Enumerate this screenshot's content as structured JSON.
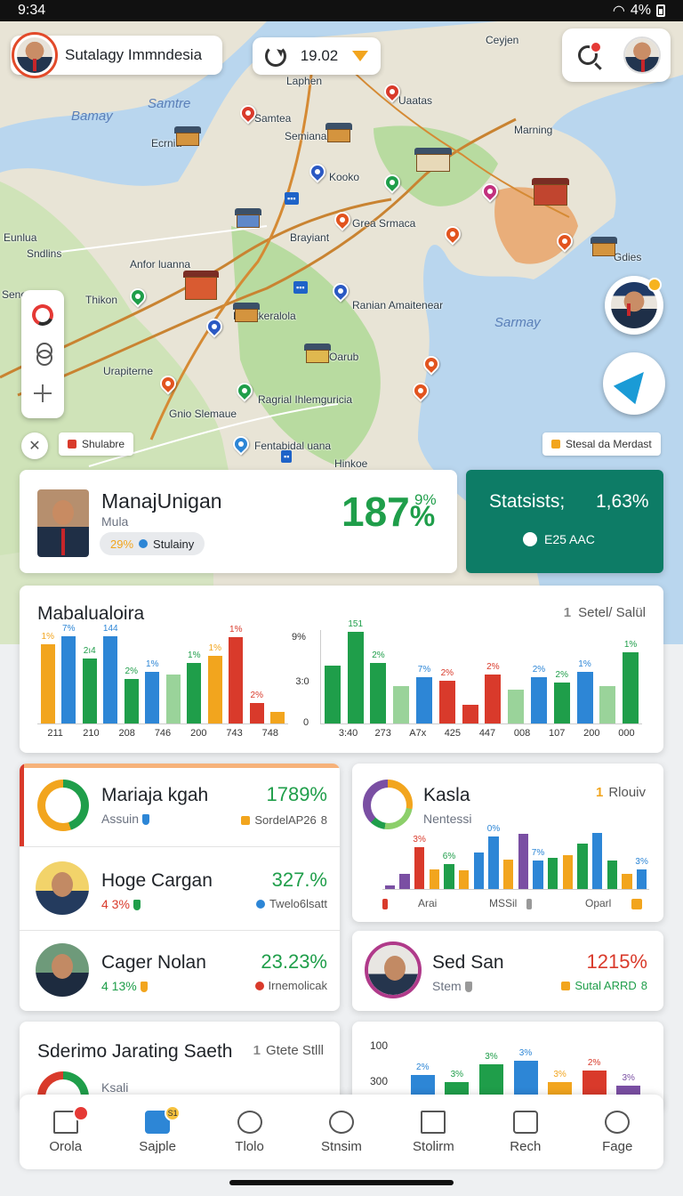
{
  "status_bar": {
    "time": "9:34",
    "battery": "4%"
  },
  "colors": {
    "green": "#1f9e4a",
    "red": "#d93a2b",
    "orange": "#f2a51e",
    "blue": "#2d86d6",
    "teal": "#0d7c66"
  },
  "search": {
    "title": "Sutalagy Immndesia"
  },
  "time_chip": {
    "value": "19.02"
  },
  "map": {
    "labels": [
      "Ceyjen",
      "Laphen",
      "Bamay",
      "Samtre",
      "Ecrnia",
      "Semiana",
      "Samtea",
      "Kooko",
      "Uaatas",
      "Marning",
      "Grea Srmaca",
      "Brayiant",
      "Anfor luanna",
      "Thikon",
      "Filcatkeralola",
      "Ranian Amaitenear",
      "Sarmay",
      "Oarub",
      "Urapiterne",
      "Ragrial Ihlemguricia",
      "Gnio Slemaue",
      "Fentabidal uana",
      "Hinkoe",
      "Sndlins",
      "Eunlua",
      "Gdies",
      "Seneo"
    ],
    "chip_left": "Shulabre",
    "chip_right": "Stesal da Merdast"
  },
  "summary": {
    "name": "ManajUnigan",
    "sub": "Mula",
    "pill_value": "29%",
    "pill_label": "Stulainy",
    "big_value": "187",
    "big_suffix": "%",
    "small_value": "9%"
  },
  "stats": {
    "title": "Statsists;",
    "value": "1,63%",
    "sub": "E25 AAC"
  },
  "chart1": {
    "title": "Mabalualoira",
    "right_label": "Setel/ Salül",
    "right_index": "1",
    "y_labels": [
      "9%",
      "3:0",
      "0"
    ],
    "left_ticks": [
      "211",
      "210",
      "208",
      "746",
      "200",
      "743",
      "748"
    ],
    "right_ticks": [
      "3:40",
      "273",
      "A7x",
      "425",
      "447",
      "008",
      "107",
      "200",
      "000"
    ]
  },
  "chart_data": [
    {
      "type": "bar",
      "title": "Mabalualoira",
      "bars": [
        {
          "label": "1%",
          "value": 85,
          "color": "#f2a51e"
        },
        {
          "label": "7%",
          "value": 93,
          "color": "#2d86d6"
        },
        {
          "label": "2ı4",
          "value": 70,
          "color": "#1f9e4a"
        },
        {
          "label": "144",
          "value": 93,
          "color": "#2d86d6"
        },
        {
          "label": "2%",
          "value": 48,
          "color": "#1f9e4a"
        },
        {
          "label": "1%",
          "value": 55,
          "color": "#2d86d6"
        },
        {
          "label": "",
          "value": 52,
          "color": "#9ad39a"
        },
        {
          "label": "1%",
          "value": 65,
          "color": "#1f9e4a"
        },
        {
          "label": "1%",
          "value": 72,
          "color": "#f2a51e"
        },
        {
          "label": "1%",
          "value": 92,
          "color": "#d93a2b"
        },
        {
          "label": "2%",
          "value": 22,
          "color": "#d93a2b"
        },
        {
          "label": "",
          "value": 12,
          "color": "#f2a51e"
        }
      ]
    },
    {
      "type": "bar",
      "bars": [
        {
          "label": "",
          "value": 62,
          "color": "#1f9e4a"
        },
        {
          "label": "151",
          "value": 98,
          "color": "#1f9e4a"
        },
        {
          "label": "2%",
          "value": 65,
          "color": "#1f9e4a"
        },
        {
          "label": "",
          "value": 40,
          "color": "#9ad39a"
        },
        {
          "label": "7%",
          "value": 50,
          "color": "#2d86d6"
        },
        {
          "label": "2%",
          "value": 46,
          "color": "#d93a2b"
        },
        {
          "label": "",
          "value": 20,
          "color": "#d93a2b"
        },
        {
          "label": "2%",
          "value": 52,
          "color": "#d93a2b"
        },
        {
          "label": "",
          "value": 36,
          "color": "#9ad39a"
        },
        {
          "label": "2%",
          "value": 50,
          "color": "#2d86d6"
        },
        {
          "label": "2%",
          "value": 44,
          "color": "#1f9e4a"
        },
        {
          "label": "1%",
          "value": 55,
          "color": "#2d86d6"
        },
        {
          "label": "",
          "value": 40,
          "color": "#9ad39a"
        },
        {
          "label": "1%",
          "value": 76,
          "color": "#1f9e4a"
        }
      ]
    },
    {
      "type": "bar",
      "title": "Kasla",
      "bars": [
        {
          "label": "",
          "value": 5,
          "color": "#7a4fa3"
        },
        {
          "label": "",
          "value": 22,
          "color": "#7a4fa3"
        },
        {
          "label": "3%",
          "value": 60,
          "color": "#d93a2b"
        },
        {
          "label": "",
          "value": 28,
          "color": "#f2a51e"
        },
        {
          "label": "6%",
          "value": 35,
          "color": "#1f9e4a"
        },
        {
          "label": "",
          "value": 26,
          "color": "#f2a51e"
        },
        {
          "label": "",
          "value": 52,
          "color": "#2d86d6"
        },
        {
          "label": "0%",
          "value": 75,
          "color": "#2d86d6"
        },
        {
          "label": "",
          "value": 42,
          "color": "#f2a51e"
        },
        {
          "label": "",
          "value": 78,
          "color": "#7a4fa3"
        },
        {
          "label": "7%",
          "value": 40,
          "color": "#2d86d6"
        },
        {
          "label": "",
          "value": 44,
          "color": "#1f9e4a"
        },
        {
          "label": "",
          "value": 48,
          "color": "#f2a51e"
        },
        {
          "label": "",
          "value": 65,
          "color": "#1f9e4a"
        },
        {
          "label": "",
          "value": 80,
          "color": "#2d86d6"
        },
        {
          "label": "",
          "value": 40,
          "color": "#1f9e4a"
        },
        {
          "label": "",
          "value": 22,
          "color": "#f2a51e"
        },
        {
          "label": "3%",
          "value": 28,
          "color": "#2d86d6"
        }
      ]
    },
    {
      "type": "bar",
      "bars": [
        {
          "label": "2%",
          "value": 45,
          "color": "#2d86d6"
        },
        {
          "label": "3%",
          "value": 30,
          "color": "#1f9e4a"
        },
        {
          "label": "3%",
          "value": 70,
          "color": "#1f9e4a"
        },
        {
          "label": "3%",
          "value": 80,
          "color": "#2d86d6"
        },
        {
          "label": "3%",
          "value": 30,
          "color": "#f2a51e"
        },
        {
          "label": "2%",
          "value": 56,
          "color": "#d93a2b"
        },
        {
          "label": "3%",
          "value": 20,
          "color": "#7a4fa3"
        }
      ]
    }
  ],
  "list": [
    {
      "name": "Mariaja kgah",
      "sub": "Assuin",
      "value": "1789%",
      "tag": "SordelAP26",
      "tag_suffix": "8"
    },
    {
      "name": "Hoge Cargan",
      "sub": "4 3%",
      "value": "327.%",
      "tag": "Twelo6lsatt"
    },
    {
      "name": "Cager Nolan",
      "sub": "4 13%",
      "value": "23.23%",
      "tag": "Irnemolicak"
    }
  ],
  "kasla": {
    "title": "Kasla",
    "index": "1",
    "label": "Rlouiv",
    "sub": "Nentessi",
    "ticks": [
      "Arai",
      "MSSil",
      "Oparl"
    ]
  },
  "sed": {
    "name": "Sed San",
    "sub": "Stem",
    "value": "1215%",
    "tag": "Sutal ARRD",
    "tag_suffix": "8"
  },
  "bottom_left": {
    "title": "Sderimo Jarating Saeth",
    "index": "1",
    "label": "Gtete Stlll",
    "sub": "Ksali"
  },
  "bottom_right": {
    "y_labels": [
      "100",
      "300"
    ]
  },
  "nav": [
    {
      "label": "Orola",
      "badge": ""
    },
    {
      "label": "Sajple",
      "badge": "S1"
    },
    {
      "label": "Tlolo",
      "badge": ""
    },
    {
      "label": "Stnsim",
      "badge": ""
    },
    {
      "label": "Stolirm",
      "badge": ""
    },
    {
      "label": "Rech",
      "badge": ""
    },
    {
      "label": "Fage",
      "badge": ""
    }
  ]
}
